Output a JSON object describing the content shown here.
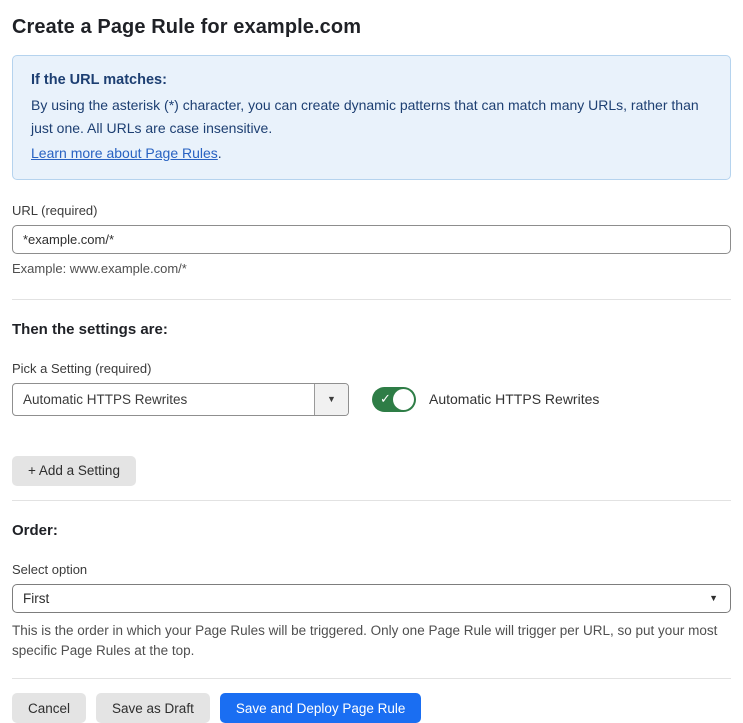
{
  "page": {
    "title": "Create a Page Rule for example.com"
  },
  "info_box": {
    "heading": "If the URL matches:",
    "body": "By using the asterisk (*) character, you can create dynamic patterns that can match many URLs, rather than just one. All URLs are case insensitive.",
    "link_text": "Learn more about Page Rules",
    "link_suffix": "."
  },
  "url_field": {
    "label": "URL (required)",
    "value": "*example.com/*",
    "example": "Example: www.example.com/*"
  },
  "settings_section": {
    "heading": "Then the settings are:",
    "pick_label": "Pick a Setting (required)",
    "selected_setting": "Automatic HTTPS Rewrites",
    "toggle_state": "on",
    "toggle_label": "Automatic HTTPS Rewrites",
    "add_setting_label": "+ Add a Setting"
  },
  "order_section": {
    "heading": "Order:",
    "select_label": "Select option",
    "selected_option": "First",
    "helper": "This is the order in which your Page Rules will be triggered. Only one Page Rule will trigger per URL, so put your most specific Page Rules at the top."
  },
  "actions": {
    "cancel_label": "Cancel",
    "save_draft_label": "Save as Draft",
    "save_deploy_label": "Save and Deploy Page Rule"
  },
  "icons": {
    "dropdown_arrow": "▼",
    "toggle_check": "✓"
  },
  "colors": {
    "primary_button_blue": "#1a6ef2",
    "toggle_green": "#2e7d46",
    "info_background": "#e9f2fb",
    "info_border": "#b5d3ee",
    "info_text": "#1d3f72",
    "link_blue": "#2862c2"
  }
}
